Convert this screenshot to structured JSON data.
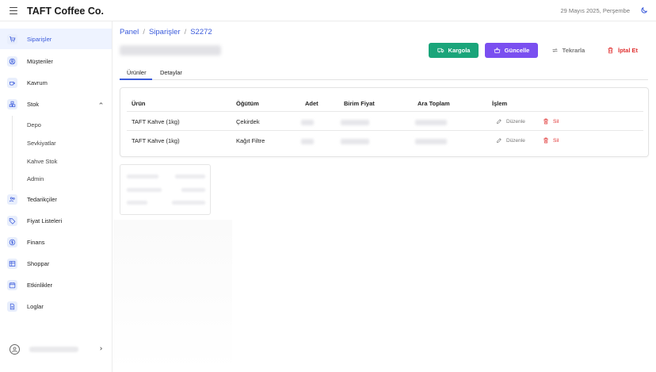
{
  "header": {
    "app_title": "TAFT Coffee Co.",
    "date": "29 Mayıs 2025, Perşembe",
    "menu_icon": "hamburger-menu-icon",
    "theme_icon": "moon-icon"
  },
  "sidebar": {
    "items": [
      {
        "label": "Siparişler",
        "icon": "cart-icon",
        "active": true
      },
      {
        "label": "Müşteriler",
        "icon": "user-circle-icon"
      },
      {
        "label": "Kavrum",
        "icon": "coffee-cup-icon"
      },
      {
        "label": "Stok",
        "icon": "boxes-icon",
        "expanded": true
      },
      {
        "label": "Tedarikçiler",
        "icon": "users-icon"
      },
      {
        "label": "Fiyat Listeleri",
        "icon": "tag-icon"
      },
      {
        "label": "Finans",
        "icon": "dollar-icon"
      },
      {
        "label": "Shoppar",
        "icon": "table-icon"
      },
      {
        "label": "Etkinlikler",
        "icon": "calendar-icon"
      },
      {
        "label": "Loglar",
        "icon": "document-icon"
      }
    ],
    "stock_subitems": [
      "Depo",
      "Sevkiyatlar",
      "Kahve Stok",
      "Admin"
    ]
  },
  "breadcrumb": [
    "Panel",
    "Siparişler",
    "S2272"
  ],
  "actions": {
    "ship_label": "Kargola",
    "update_label": "Güncelle",
    "repeat_label": "Tekrarla",
    "cancel_label": "İptal Et"
  },
  "tabs": [
    "Ürünler",
    "Detaylar"
  ],
  "table": {
    "columns": [
      "Ürün",
      "Öğütüm",
      "Adet",
      "Birim Fiyat",
      "Ara Toplam",
      "İşlem"
    ],
    "rows": [
      {
        "product": "TAFT Kahve (1kg)",
        "grind": "Çekirdek"
      },
      {
        "product": "TAFT Kahve (1kg)",
        "grind": "Kağıt Filtre"
      }
    ],
    "edit_label": "Düzenle",
    "delete_label": "Sil"
  },
  "colors": {
    "accent": "#3b5bdb",
    "ship": "#1aa57a",
    "update": "#7a4ff0",
    "danger": "#e03131"
  }
}
